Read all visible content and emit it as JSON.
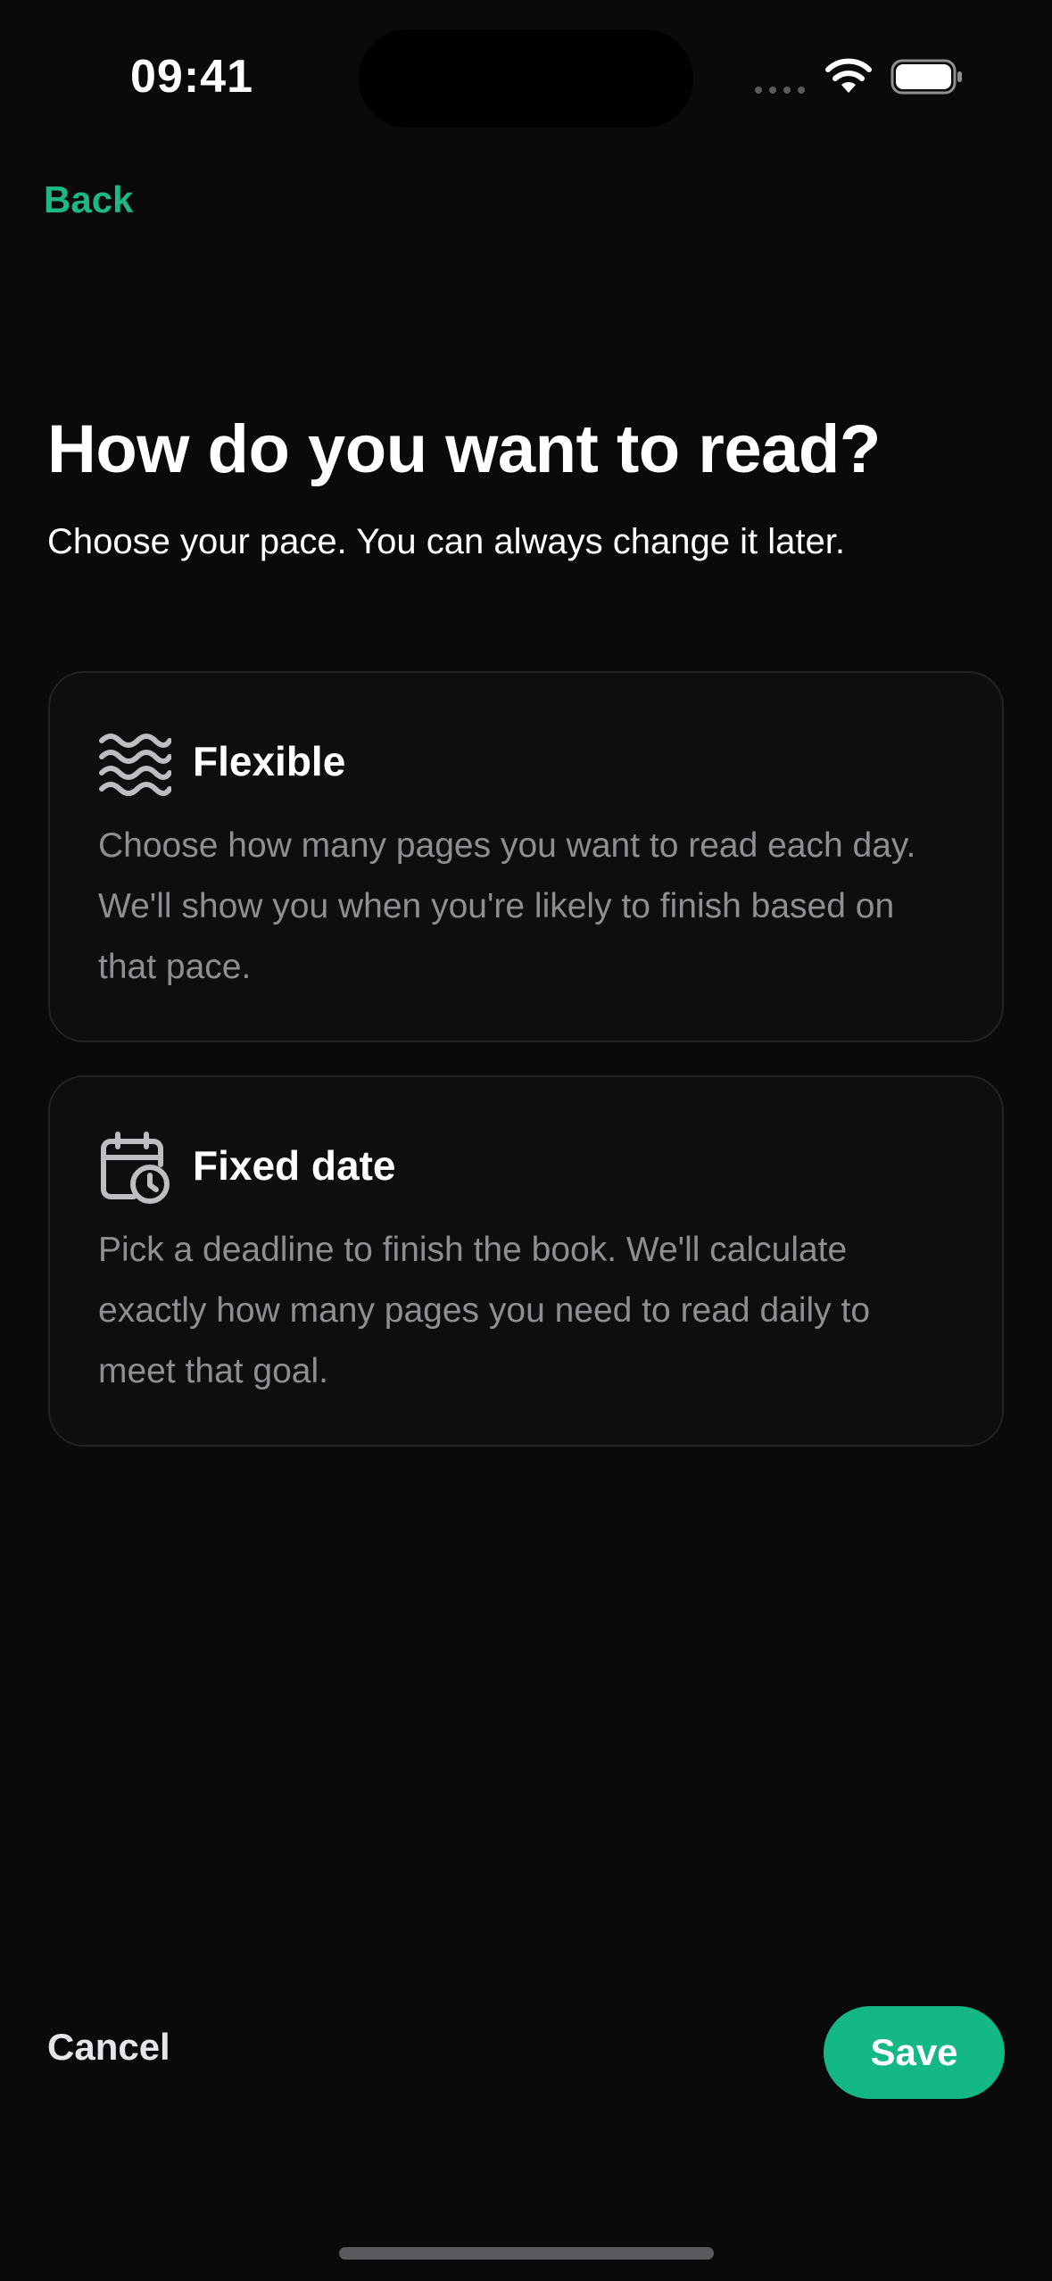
{
  "status_bar": {
    "time": "09:41"
  },
  "nav": {
    "back_label": "Back"
  },
  "header": {
    "title": "How do you want to read?",
    "subtitle": "Choose your pace. You can always change it later."
  },
  "options": [
    {
      "icon": "waves-icon",
      "title": "Flexible",
      "description": "Choose how many pages you want to read each day. We'll show you when you're likely to finish based on that pace."
    },
    {
      "icon": "calendar-clock-icon",
      "title": "Fixed date",
      "description": "Pick a deadline to finish the book. We'll calculate exactly how many pages you need to read daily to meet that goal."
    }
  ],
  "footer": {
    "cancel_label": "Cancel",
    "save_label": "Save"
  },
  "colors": {
    "accent": "#14B885",
    "background": "#0A0A0C",
    "card_border": "#232326",
    "muted_text": "#8E8E93"
  }
}
